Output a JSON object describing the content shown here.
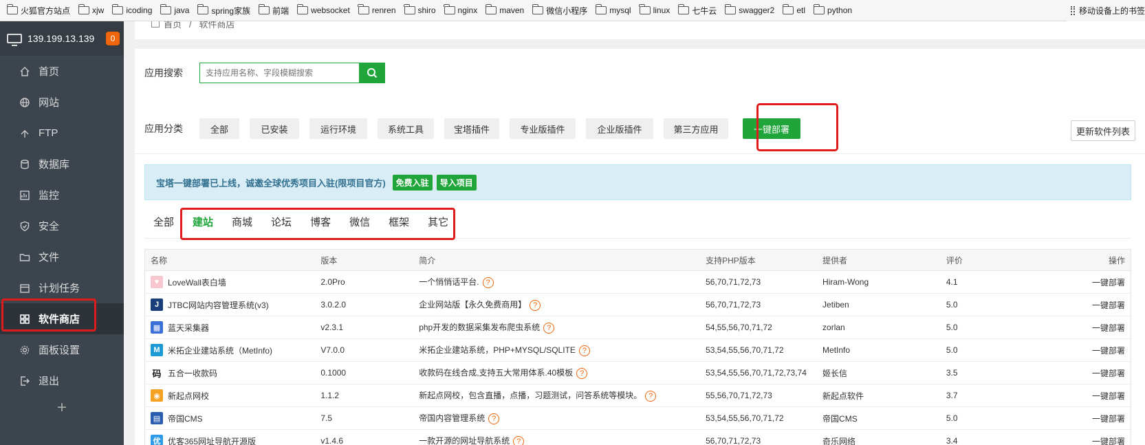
{
  "bookmarks": [
    "火狐官方站点",
    "xjw",
    "icoding",
    "java",
    "spring家族",
    "前端",
    "websocket",
    "renren",
    "shiro",
    "nginx",
    "maven",
    "微信小程序",
    "mysql",
    "linux",
    "七牛云",
    "swagger2",
    "etl",
    "python"
  ],
  "bookmarks_right": "移动设备上的书签",
  "sidebar": {
    "server_ip": "139.199.13.139",
    "badge": "0",
    "items": [
      {
        "label": "首页",
        "icon": "home-icon"
      },
      {
        "label": "网站",
        "icon": "globe-icon"
      },
      {
        "label": "FTP",
        "icon": "ftp-icon"
      },
      {
        "label": "数据库",
        "icon": "database-icon"
      },
      {
        "label": "监控",
        "icon": "monitor-icon"
      },
      {
        "label": "安全",
        "icon": "shield-icon"
      },
      {
        "label": "文件",
        "icon": "folder-icon"
      },
      {
        "label": "计划任务",
        "icon": "calendar-icon"
      },
      {
        "label": "软件商店",
        "icon": "grid-icon",
        "active": true
      },
      {
        "label": "面板设置",
        "icon": "gear-icon"
      },
      {
        "label": "退出",
        "icon": "logout-icon"
      }
    ],
    "add": "+"
  },
  "breadcrumb": {
    "home": "首页",
    "sep": "/",
    "current": "软件商店"
  },
  "search": {
    "label": "应用搜索",
    "placeholder": "支持应用名称、字段模糊搜索"
  },
  "category": {
    "label": "应用分类",
    "items": [
      "全部",
      "已安装",
      "运行环境",
      "系统工具",
      "宝塔插件",
      "专业版插件",
      "企业版插件",
      "第三方应用",
      "一键部署"
    ],
    "selected": "一键部署"
  },
  "update_button": "更新软件列表",
  "notice": {
    "text": "宝塔一键部署已上线，诚邀全球优秀项目入驻(限项目官方)",
    "btn_free": "免费入驻",
    "btn_import": "导入项目"
  },
  "subtabs": {
    "items": [
      "全部",
      "建站",
      "商城",
      "论坛",
      "博客",
      "微信",
      "框架",
      "其它"
    ],
    "selected": "建站"
  },
  "table": {
    "headers": [
      "名称",
      "版本",
      "简介",
      "支持PHP版本",
      "提供者",
      "评价",
      "操作"
    ],
    "rows": [
      {
        "name": "LoveWall表白墙",
        "version": "2.0Pro",
        "desc": "一个悄悄话平台.",
        "php": "56,70,71,72,73",
        "provider": "Hiram-Wong",
        "score": "4.1",
        "action": "一键部署",
        "logo_bg": "#f7c6cf",
        "logo_text": "♥"
      },
      {
        "name": "JTBC网站内容管理系统(v3)",
        "version": "3.0.2.0",
        "desc": "企业网站版【永久免费商用】",
        "php": "56,70,71,72,73",
        "provider": "Jetiben",
        "score": "5.0",
        "action": "一键部署",
        "logo_bg": "#1a3d7c",
        "logo_text": "J"
      },
      {
        "name": "蓝天采集器",
        "version": "v2.3.1",
        "desc": "php开发的数据采集发布爬虫系统",
        "php": "54,55,56,70,71,72",
        "provider": "zorlan",
        "score": "5.0",
        "action": "一键部署",
        "logo_bg": "#3b6fd8",
        "logo_text": "▦"
      },
      {
        "name": "米拓企业建站系统（MetInfo)",
        "version": "V7.0.0",
        "desc": "米拓企业建站系统，PHP+MYSQL/SQLITE",
        "php": "53,54,55,56,70,71,72",
        "provider": "MetInfo",
        "score": "5.0",
        "action": "一键部署",
        "logo_bg": "#1b9ad6",
        "logo_text": "M"
      },
      {
        "name": "五合一收款码",
        "version": "0.1000",
        "desc": "收款码在线合成,支持五大常用体系.40模板",
        "php": "53,54,55,56,70,71,72,73,74",
        "provider": "姬长信",
        "score": "3.5",
        "action": "一键部署",
        "logo_bg": "#ffffff",
        "logo_text": "码"
      },
      {
        "name": "新起点网校",
        "version": "1.1.2",
        "desc": "新起点网校，包含直播，点播，习题测试，问答系统等模块。",
        "php": "55,56,70,71,72,73",
        "provider": "新起点软件",
        "score": "3.7",
        "action": "一键部署",
        "logo_bg": "#f4a020",
        "logo_text": "◉"
      },
      {
        "name": "帝国CMS",
        "version": "7.5",
        "desc": "帝国内容管理系统",
        "php": "53,54,55,56,70,71,72",
        "provider": "帝国CMS",
        "score": "5.0",
        "action": "一键部署",
        "logo_bg": "#2a5db0",
        "logo_text": "▤"
      },
      {
        "name": "优客365网址导航开源版",
        "version": "v1.4.6",
        "desc": "一款开源的网址导航系统",
        "php": "56,70,71,72,73",
        "provider": "奇乐网络",
        "score": "3.4",
        "action": "一键部署",
        "logo_bg": "#2f9be6",
        "logo_text": "优"
      }
    ]
  },
  "colors": {
    "accent": "#20a53a",
    "sidebar_bg": "#3c444d",
    "highlight": "#e01b1b",
    "help": "#f0640a"
  }
}
